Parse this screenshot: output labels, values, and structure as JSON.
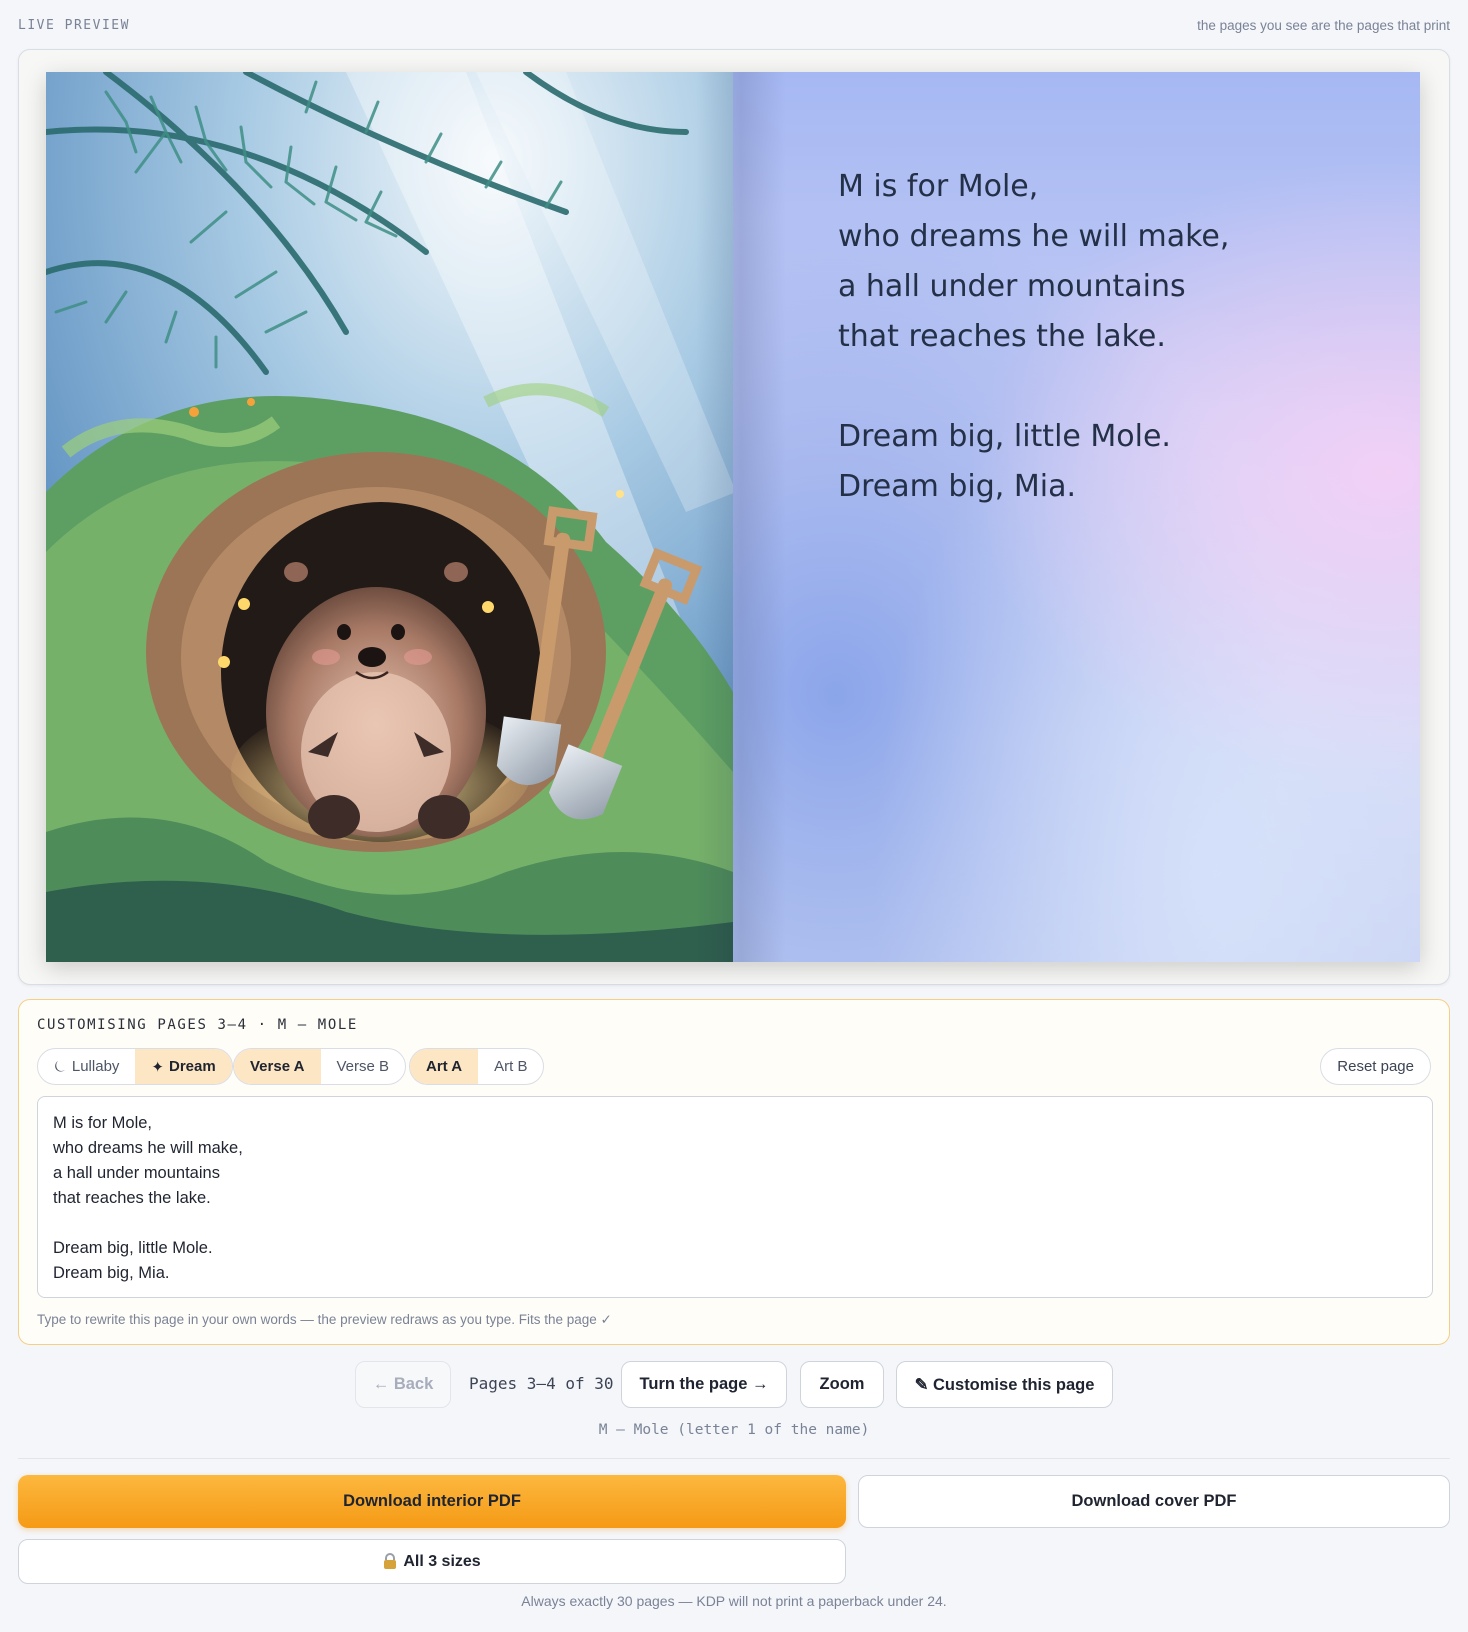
{
  "header": {
    "label": "LIVE PREVIEW",
    "note": "the pages you see are the pages that print"
  },
  "book": {
    "illustration": "watercolor-mole-burrow-with-shovels",
    "verse_lines": [
      "M is for Mole,",
      "who dreams he will make,",
      "a hall under mountains",
      "that reaches the lake.",
      "",
      "Dream big, little Mole.",
      "Dream big, Mia."
    ]
  },
  "customise": {
    "title": "CUSTOMISING PAGES 3–4 · M — MOLE",
    "style_options": [
      {
        "icon": "moon-icon",
        "glyph": "⏾",
        "label": "Lullaby",
        "active": false
      },
      {
        "icon": "sparkle-icon",
        "glyph": "✦",
        "label": "Dream",
        "active": true
      }
    ],
    "verse_options": [
      {
        "label": "Verse A",
        "active": true
      },
      {
        "label": "Verse B",
        "active": false
      }
    ],
    "art_options": [
      {
        "label": "Art A",
        "active": true
      },
      {
        "label": "Art B",
        "active": false
      }
    ],
    "reset_label": "Reset page",
    "editor_text": "M is for Mole,\nwho dreams he will make,\na hall under mountains\nthat reaches the lake.\n\nDream big, little Mole.\nDream big, Mia.",
    "hint": "Type to rewrite this page in your own words — the preview redraws as you type. Fits the page ✓"
  },
  "nav": {
    "back_label": "← Back",
    "page_count": "Pages 3–4 of 30",
    "next_label": "Turn the page →",
    "zoom_label": "Zoom",
    "customise_label": "✎ Customise this page",
    "letter_note": "M — Mole (letter 1 of the name)"
  },
  "downloads": {
    "interior_label": "Download interior PDF",
    "cover_label": "Download cover PDF",
    "sizes_label": "All 3 sizes",
    "sizes_icon": "lock-icon",
    "footnote": "Always exactly 30 pages — KDP will not print a paperback under 24."
  },
  "colors": {
    "accent": "#f59a16",
    "panel_border": "#f6cf86",
    "active_segment": "#fde6c4",
    "background": "#f4f6fa"
  }
}
